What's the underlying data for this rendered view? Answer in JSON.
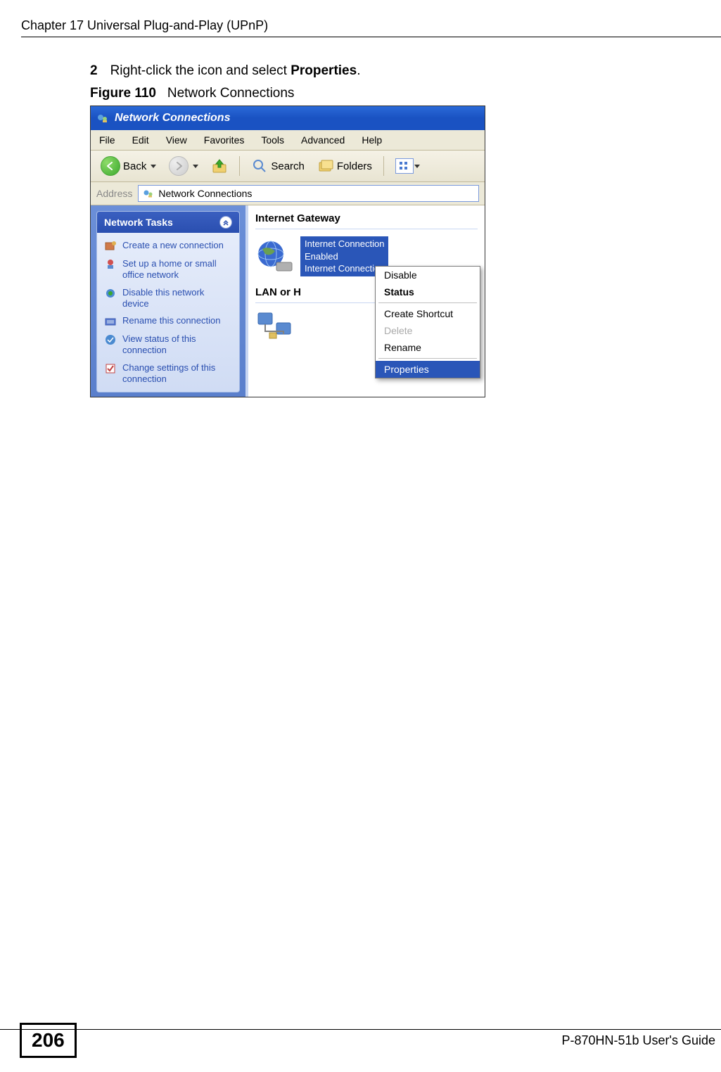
{
  "header": {
    "chapter": "Chapter 17 Universal Plug-and-Play (UPnP)"
  },
  "step": {
    "number": "2",
    "text_before": "Right-click the icon and select ",
    "bold": "Properties",
    "text_after": "."
  },
  "figure": {
    "label": "Figure 110",
    "caption": "Network Connections"
  },
  "window": {
    "title": "Network Connections",
    "menu": {
      "file": "File",
      "edit": "Edit",
      "view": "View",
      "favorites": "Favorites",
      "tools": "Tools",
      "advanced": "Advanced",
      "help": "Help"
    },
    "toolbar": {
      "back": "Back",
      "search": "Search",
      "folders": "Folders"
    },
    "address": {
      "label": "Address",
      "value": "Network Connections"
    },
    "sidebar": {
      "panel_title": "Network Tasks",
      "tasks": [
        "Create a new connection",
        "Set up a home or small office network",
        "Disable this network device",
        "Rename this connection",
        "View status of this connection",
        "Change settings of this connection"
      ]
    },
    "main": {
      "group1": "Internet Gateway",
      "conn_line1": "Internet Connection",
      "conn_line2": "Enabled",
      "conn_line3": "Internet Connection",
      "group2": "LAN or H"
    },
    "context_menu": {
      "disable": "Disable",
      "status": "Status",
      "create_shortcut": "Create Shortcut",
      "delete": "Delete",
      "rename": "Rename",
      "properties": "Properties"
    }
  },
  "footer": {
    "page": "206",
    "guide": "P-870HN-51b User's Guide"
  }
}
